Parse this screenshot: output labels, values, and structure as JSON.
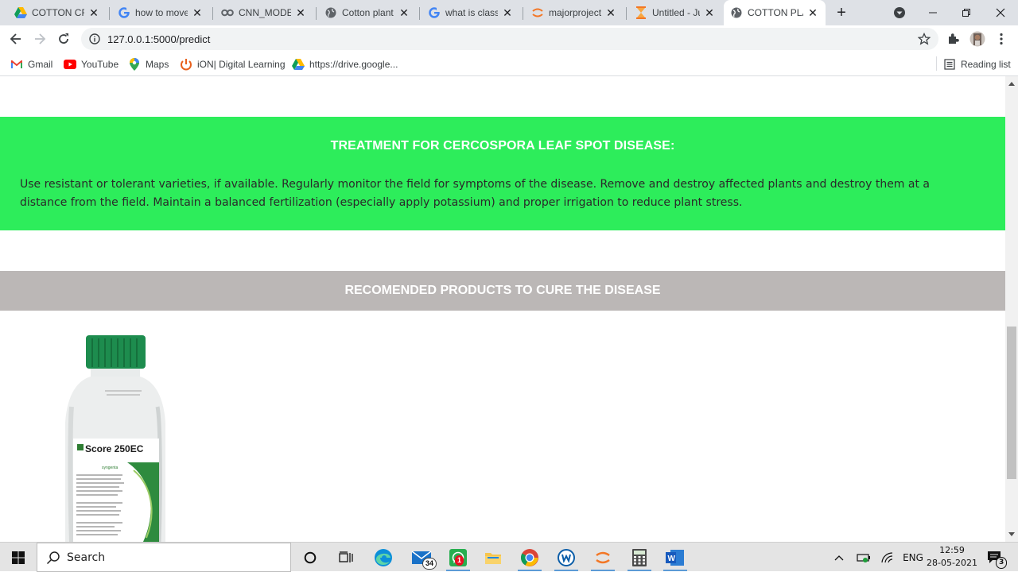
{
  "browser": {
    "tabs": [
      {
        "title": "COTTON CRO",
        "icon": "google-drive-icon",
        "active": false
      },
      {
        "title": "how to move",
        "icon": "google-icon",
        "active": false
      },
      {
        "title": "CNN_MODEL",
        "icon": "colab-icon",
        "active": false
      },
      {
        "title": "Cotton plant",
        "icon": "globe-icon",
        "active": false
      },
      {
        "title": "what is classif",
        "icon": "google-icon",
        "active": false
      },
      {
        "title": "majorproject/",
        "icon": "jupyter-icon",
        "active": false
      },
      {
        "title": "Untitled - Jup",
        "icon": "hourglass-icon",
        "active": false
      },
      {
        "title": "COTTON PLA",
        "icon": "globe-icon",
        "active": true
      }
    ],
    "address_bar": {
      "url": "127.0.0.1:5000/predict"
    },
    "bookmarks": [
      {
        "label": "Gmail",
        "icon": "gmail-icon"
      },
      {
        "label": "YouTube",
        "icon": "youtube-icon"
      },
      {
        "label": "Maps",
        "icon": "maps-icon"
      },
      {
        "label": "iON| Digital Learning",
        "icon": "ion-icon"
      },
      {
        "label": "https://drive.google...",
        "icon": "google-drive-icon"
      }
    ],
    "reading_list_label": "Reading list"
  },
  "page": {
    "treatment": {
      "heading": "TREATMENT FOR CERCOSPORA LEAF SPOT DISEASE:",
      "body": "Use resistant or tolerant varieties, if available. Regularly monitor the field for symptoms of the disease. Remove and destroy affected plants and destroy them at a distance from the field. Maintain a balanced fertilization (especially apply potassium) and proper irrigation to reduce plant stress."
    },
    "products": {
      "heading": "RECOMENDED PRODUCTS TO CURE THE DISEASE",
      "items": [
        {
          "name": "Score 250EC",
          "brand": "syngenta"
        }
      ]
    }
  },
  "taskbar": {
    "search_placeholder": "Search",
    "mail_badge": "34",
    "whatsapp_badge": "1",
    "language": "ENG",
    "time": "12:59",
    "date": "28-05-2021",
    "notification_count": "3"
  },
  "colors": {
    "treatment_bg": "#2ded5b",
    "products_header_bg": "#bbb7b6",
    "tabstrip_bg": "#dee1e6"
  }
}
